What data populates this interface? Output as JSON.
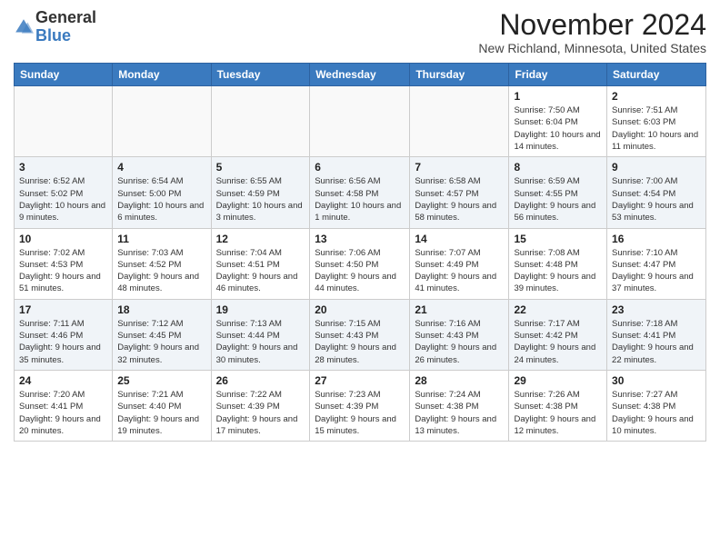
{
  "header": {
    "logo_general": "General",
    "logo_blue": "Blue",
    "month_title": "November 2024",
    "location": "New Richland, Minnesota, United States"
  },
  "weekdays": [
    "Sunday",
    "Monday",
    "Tuesday",
    "Wednesday",
    "Thursday",
    "Friday",
    "Saturday"
  ],
  "weeks": [
    [
      {
        "day": "",
        "info": ""
      },
      {
        "day": "",
        "info": ""
      },
      {
        "day": "",
        "info": ""
      },
      {
        "day": "",
        "info": ""
      },
      {
        "day": "",
        "info": ""
      },
      {
        "day": "1",
        "info": "Sunrise: 7:50 AM\nSunset: 6:04 PM\nDaylight: 10 hours\nand 14 minutes."
      },
      {
        "day": "2",
        "info": "Sunrise: 7:51 AM\nSunset: 6:03 PM\nDaylight: 10 hours\nand 11 minutes."
      }
    ],
    [
      {
        "day": "3",
        "info": "Sunrise: 6:52 AM\nSunset: 5:02 PM\nDaylight: 10 hours\nand 9 minutes."
      },
      {
        "day": "4",
        "info": "Sunrise: 6:54 AM\nSunset: 5:00 PM\nDaylight: 10 hours\nand 6 minutes."
      },
      {
        "day": "5",
        "info": "Sunrise: 6:55 AM\nSunset: 4:59 PM\nDaylight: 10 hours\nand 3 minutes."
      },
      {
        "day": "6",
        "info": "Sunrise: 6:56 AM\nSunset: 4:58 PM\nDaylight: 10 hours\nand 1 minute."
      },
      {
        "day": "7",
        "info": "Sunrise: 6:58 AM\nSunset: 4:57 PM\nDaylight: 9 hours\nand 58 minutes."
      },
      {
        "day": "8",
        "info": "Sunrise: 6:59 AM\nSunset: 4:55 PM\nDaylight: 9 hours\nand 56 minutes."
      },
      {
        "day": "9",
        "info": "Sunrise: 7:00 AM\nSunset: 4:54 PM\nDaylight: 9 hours\nand 53 minutes."
      }
    ],
    [
      {
        "day": "10",
        "info": "Sunrise: 7:02 AM\nSunset: 4:53 PM\nDaylight: 9 hours\nand 51 minutes."
      },
      {
        "day": "11",
        "info": "Sunrise: 7:03 AM\nSunset: 4:52 PM\nDaylight: 9 hours\nand 48 minutes."
      },
      {
        "day": "12",
        "info": "Sunrise: 7:04 AM\nSunset: 4:51 PM\nDaylight: 9 hours\nand 46 minutes."
      },
      {
        "day": "13",
        "info": "Sunrise: 7:06 AM\nSunset: 4:50 PM\nDaylight: 9 hours\nand 44 minutes."
      },
      {
        "day": "14",
        "info": "Sunrise: 7:07 AM\nSunset: 4:49 PM\nDaylight: 9 hours\nand 41 minutes."
      },
      {
        "day": "15",
        "info": "Sunrise: 7:08 AM\nSunset: 4:48 PM\nDaylight: 9 hours\nand 39 minutes."
      },
      {
        "day": "16",
        "info": "Sunrise: 7:10 AM\nSunset: 4:47 PM\nDaylight: 9 hours\nand 37 minutes."
      }
    ],
    [
      {
        "day": "17",
        "info": "Sunrise: 7:11 AM\nSunset: 4:46 PM\nDaylight: 9 hours\nand 35 minutes."
      },
      {
        "day": "18",
        "info": "Sunrise: 7:12 AM\nSunset: 4:45 PM\nDaylight: 9 hours\nand 32 minutes."
      },
      {
        "day": "19",
        "info": "Sunrise: 7:13 AM\nSunset: 4:44 PM\nDaylight: 9 hours\nand 30 minutes."
      },
      {
        "day": "20",
        "info": "Sunrise: 7:15 AM\nSunset: 4:43 PM\nDaylight: 9 hours\nand 28 minutes."
      },
      {
        "day": "21",
        "info": "Sunrise: 7:16 AM\nSunset: 4:43 PM\nDaylight: 9 hours\nand 26 minutes."
      },
      {
        "day": "22",
        "info": "Sunrise: 7:17 AM\nSunset: 4:42 PM\nDaylight: 9 hours\nand 24 minutes."
      },
      {
        "day": "23",
        "info": "Sunrise: 7:18 AM\nSunset: 4:41 PM\nDaylight: 9 hours\nand 22 minutes."
      }
    ],
    [
      {
        "day": "24",
        "info": "Sunrise: 7:20 AM\nSunset: 4:41 PM\nDaylight: 9 hours\nand 20 minutes."
      },
      {
        "day": "25",
        "info": "Sunrise: 7:21 AM\nSunset: 4:40 PM\nDaylight: 9 hours\nand 19 minutes."
      },
      {
        "day": "26",
        "info": "Sunrise: 7:22 AM\nSunset: 4:39 PM\nDaylight: 9 hours\nand 17 minutes."
      },
      {
        "day": "27",
        "info": "Sunrise: 7:23 AM\nSunset: 4:39 PM\nDaylight: 9 hours\nand 15 minutes."
      },
      {
        "day": "28",
        "info": "Sunrise: 7:24 AM\nSunset: 4:38 PM\nDaylight: 9 hours\nand 13 minutes."
      },
      {
        "day": "29",
        "info": "Sunrise: 7:26 AM\nSunset: 4:38 PM\nDaylight: 9 hours\nand 12 minutes."
      },
      {
        "day": "30",
        "info": "Sunrise: 7:27 AM\nSunset: 4:38 PM\nDaylight: 9 hours\nand 10 minutes."
      }
    ]
  ]
}
